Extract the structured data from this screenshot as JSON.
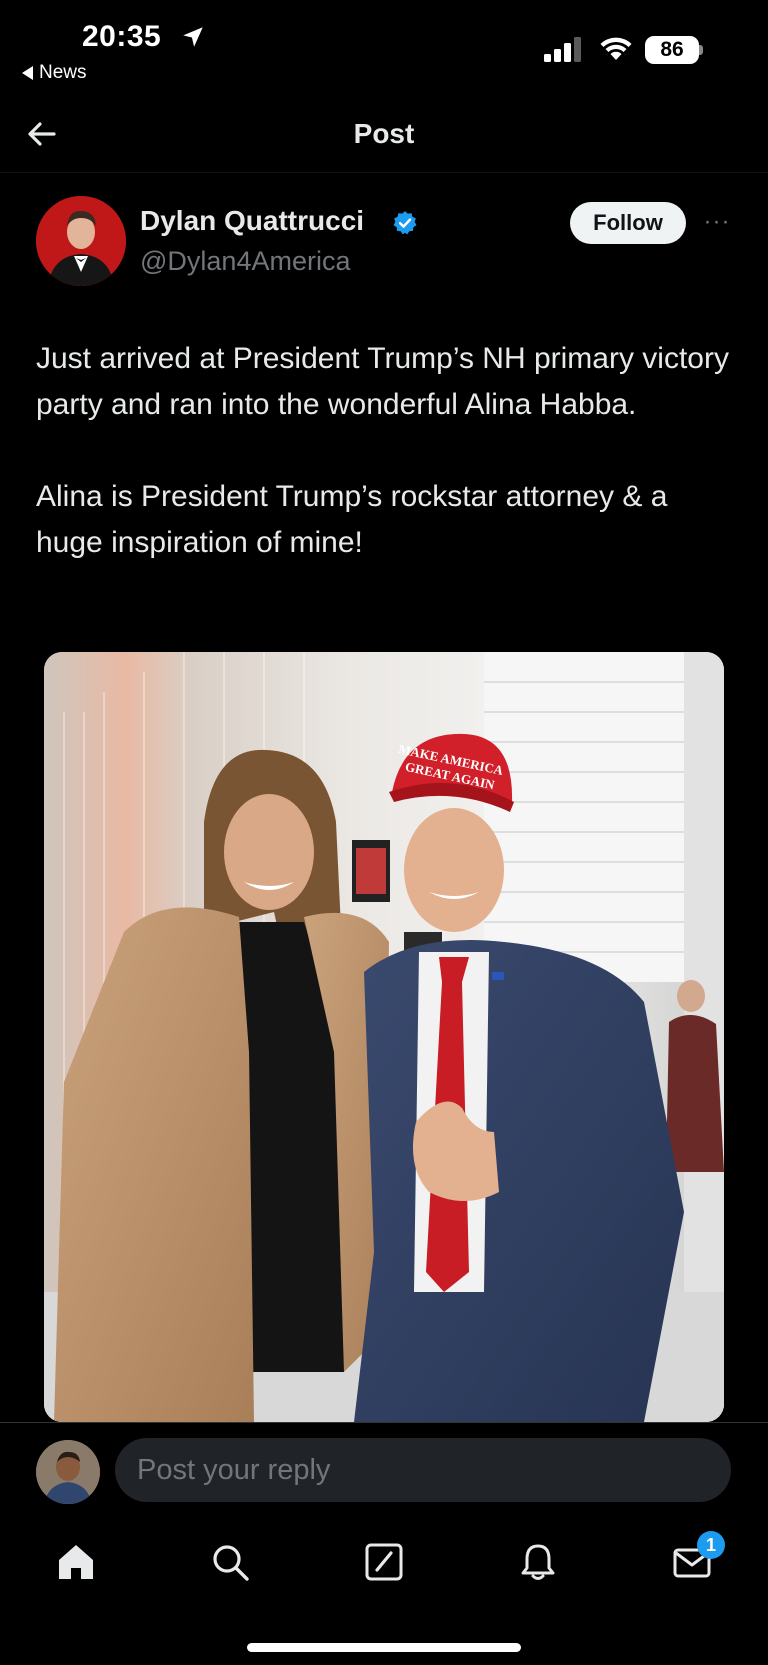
{
  "status_bar": {
    "time": "20:35",
    "back_app_label": "News",
    "battery": "86",
    "icons": [
      "location-arrow-icon",
      "signal-icon",
      "wifi-icon",
      "battery-icon"
    ]
  },
  "header": {
    "title": "Post",
    "back_icon": "arrow-left-icon"
  },
  "post": {
    "author": {
      "name": "Dylan Quattrucci",
      "handle": "@Dylan4America",
      "verified": true,
      "verified_color": "#1d9bf0"
    },
    "follow_label": "Follow",
    "more_label": "···",
    "text_paragraphs": [
      "Just arrived at President Trump’s NH primary victory party and ran into the wonderful Alina Habba.",
      "Alina is President Trump’s rockstar attorney & a huge inspiration of mine!"
    ],
    "media": {
      "hat_text_line1": "MAKE AMERICA",
      "hat_text_line2": "GREAT AGAIN"
    }
  },
  "reply": {
    "placeholder": "Post your reply"
  },
  "tab_bar": {
    "items": [
      {
        "icon": "home-icon"
      },
      {
        "icon": "search-icon"
      },
      {
        "icon": "compose-icon"
      },
      {
        "icon": "bell-icon"
      },
      {
        "icon": "mail-icon"
      }
    ],
    "mail_badge": "1",
    "badge_color": "#1d9bf0"
  },
  "colors": {
    "background": "#000000",
    "text": "#e7e9ea",
    "secondary_text": "#71767b",
    "accent": "#1d9bf0"
  }
}
